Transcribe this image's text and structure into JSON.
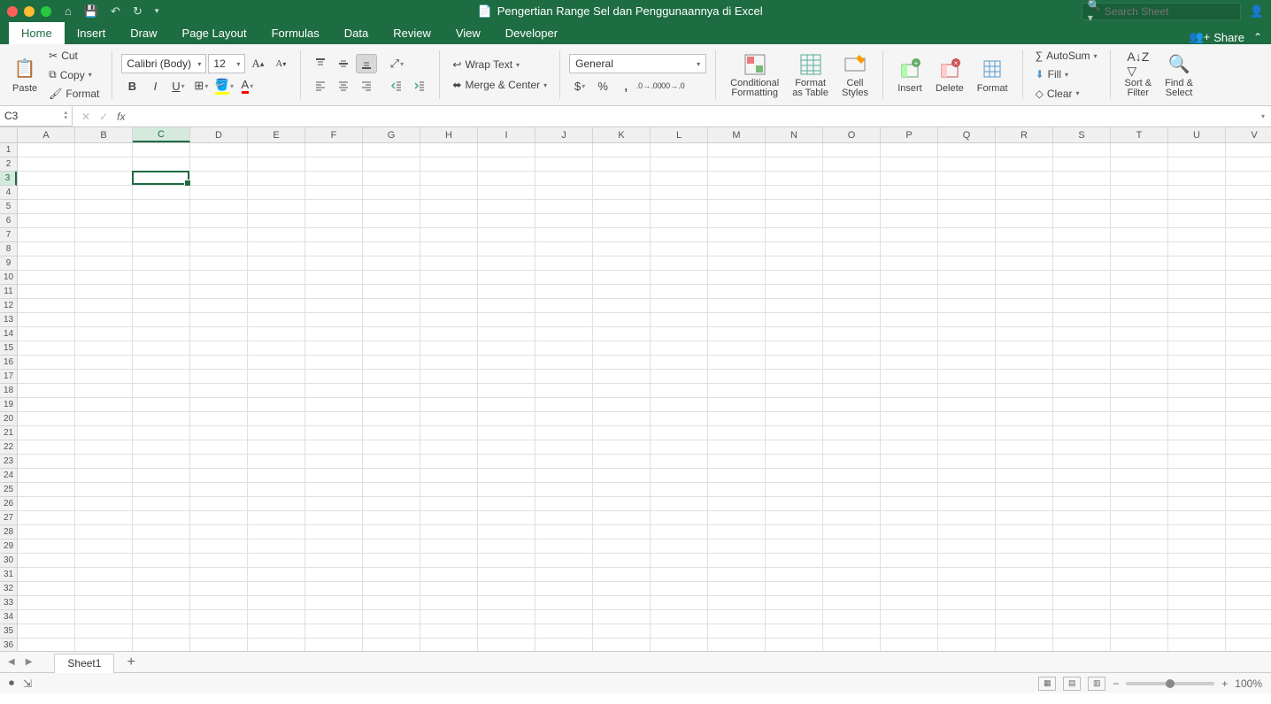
{
  "titlebar": {
    "title": "Pengertian Range Sel dan Penggunaannya di Excel",
    "search_placeholder": "Search Sheet"
  },
  "tabs": {
    "items": [
      "Home",
      "Insert",
      "Draw",
      "Page Layout",
      "Formulas",
      "Data",
      "Review",
      "View",
      "Developer"
    ],
    "active": 0,
    "share": "Share"
  },
  "ribbon": {
    "paste": "Paste",
    "cut": "Cut",
    "copy": "Copy",
    "format_painter": "Format",
    "font_name": "Calibri (Body)",
    "font_size": "12",
    "wrap_text": "Wrap Text",
    "merge_center": "Merge & Center",
    "number_format": "General",
    "cond_format": "Conditional\nFormatting",
    "format_table": "Format\nas Table",
    "cell_styles": "Cell\nStyles",
    "insert": "Insert",
    "delete": "Delete",
    "format": "Format",
    "autosum": "AutoSum",
    "fill": "Fill",
    "clear": "Clear",
    "sort_filter": "Sort &\nFilter",
    "find_select": "Find &\nSelect"
  },
  "fx": {
    "cell_ref": "C3",
    "fx_label": "fx"
  },
  "sheet": {
    "cols": [
      "A",
      "B",
      "C",
      "D",
      "E",
      "F",
      "G",
      "H",
      "I",
      "J",
      "K",
      "L",
      "M",
      "N",
      "O",
      "P",
      "Q",
      "R",
      "S",
      "T",
      "U",
      "V"
    ],
    "rows": 36,
    "selected_col": 2,
    "selected_row": 2,
    "tab_name": "Sheet1"
  },
  "status": {
    "zoom": "100%"
  }
}
